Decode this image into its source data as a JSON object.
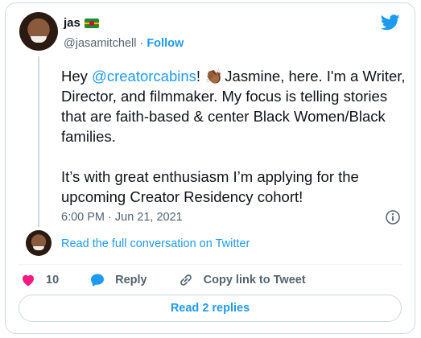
{
  "author": {
    "name": "jas",
    "handle": "@jasamitchell",
    "separator": "·",
    "follow_label": "Follow"
  },
  "tweet": {
    "text_before_mention": "Hey ",
    "mention": "@creatorcabins",
    "text_after_mention": "! ",
    "emoji": "👏🏾",
    "text_rest": " Jasmine, here. I'm a Writer, Director, and filmmaker. My focus is telling stories that are faith-based & center Black Women/Black families.\n\nIt’s with great enthusiasm I’m applying for the upcoming Creator Residency cohort!",
    "timestamp": "6:00 PM · Jun 21, 2021"
  },
  "conversation": {
    "read_full_label": "Read the full conversation on Twitter"
  },
  "actions": {
    "like_count": "10",
    "reply_label": "Reply",
    "copy_link_label": "Copy link to Tweet"
  },
  "replies": {
    "button_label": "Read 2 replies"
  },
  "colors": {
    "accent": "#1d9bf0",
    "like": "#f91880",
    "muted": "#536471",
    "border": "#cfd9de"
  },
  "icons": [
    "twitter-bird-icon",
    "info-icon",
    "heart-icon",
    "reply-bubble-icon",
    "link-icon",
    "dominica-flag-icon"
  ]
}
